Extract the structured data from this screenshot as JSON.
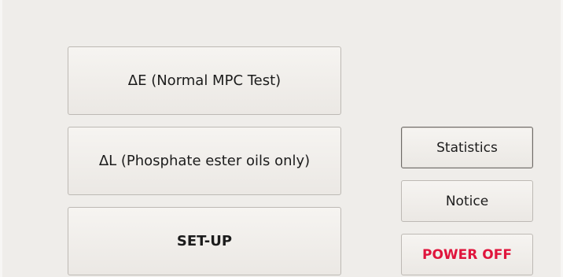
{
  "menu": {
    "delta_e_label": "ΔE (Normal MPC Test)",
    "delta_l_label": "ΔL (Phosphate ester oils only)",
    "setup_label": "SET-UP"
  },
  "side": {
    "statistics_label": "Statistics",
    "notice_label": "Notice",
    "power_off_label": "POWER OFF"
  },
  "colors": {
    "background": "#efedea",
    "power_off_text": "#e0143c",
    "button_border": "#bdb9b4"
  }
}
